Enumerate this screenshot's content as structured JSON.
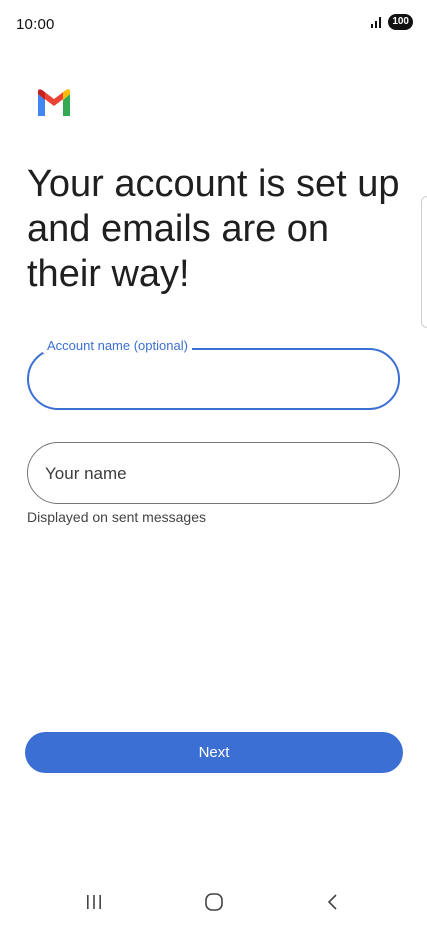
{
  "status_bar": {
    "time": "10:00",
    "battery": "100",
    "signal_icon": "signal-bars-icon"
  },
  "app": {
    "logo_icon": "gmail-logo-icon",
    "headline": "Your account is set up and emails are on their way!"
  },
  "form": {
    "account_name_label": "Account name (optional)",
    "account_name_value": "",
    "your_name_placeholder": "Your name",
    "your_name_value": "",
    "your_name_helper": "Displayed on sent messages"
  },
  "actions": {
    "next_label": "Next"
  },
  "nav": {
    "recents_icon": "recents-icon",
    "home_icon": "home-icon",
    "back_icon": "back-icon"
  },
  "colors": {
    "accent": "#3b6fd4",
    "text": "#1f1f1f",
    "outline": "#757575"
  }
}
